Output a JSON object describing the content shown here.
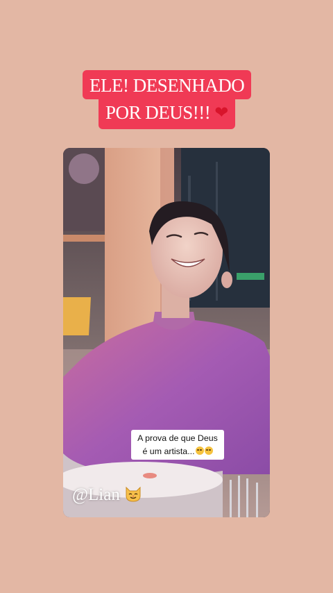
{
  "headline": {
    "line1": "ELE! DESENHADO",
    "line2": "POR DEUS!!!",
    "heart_icon": "red-heart-icon"
  },
  "caption": {
    "line1": "A prova de que Deus",
    "line2": "é um artista...",
    "emoji_icons": [
      "relieved-face-icon",
      "relieved-face-icon"
    ]
  },
  "mention": {
    "text": "@Lian",
    "icon": "cat-face-icon"
  },
  "colors": {
    "background": "#e3b7a4",
    "headline_bg": "#f03a55",
    "headline_text": "#ffffff",
    "heart": "#d8142b"
  }
}
